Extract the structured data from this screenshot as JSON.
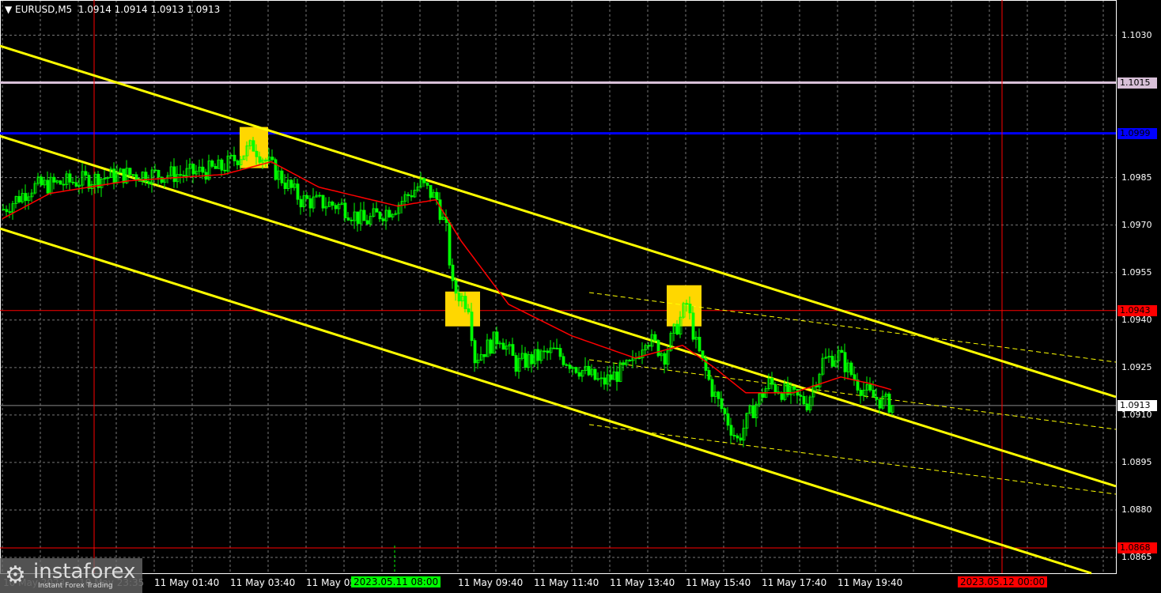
{
  "header": {
    "symbol": "EURUSD,M5",
    "ohlc": "1.0914 1.0914 1.0913 1.0913"
  },
  "logo": {
    "name": "instaforex",
    "tagline": "Instant Forex Trading"
  },
  "colors": {
    "bull": "#00ff00",
    "ma": "#ff0000",
    "channel": "#ffff00",
    "level_main": "#0000ff",
    "level_resist": "#d8c0d8",
    "level_red": "#ff0000",
    "box": "#ffd700"
  },
  "chart_data": {
    "type": "candlestick",
    "title": "EURUSD,M5",
    "ylim": [
      1.086,
      1.1042
    ],
    "y_ticks": [
      "1.1030",
      "1.1015",
      "1.0999",
      "1.0985",
      "1.0970",
      "1.0955",
      "1.0943",
      "1.0940",
      "1.0925",
      "1.0913",
      "1.0910",
      "1.0895",
      "1.0880",
      "1.0868",
      "1.0865"
    ],
    "x_ticks": [
      "10 May 2023",
      "10 May 23:35",
      "11 May 01:40",
      "11 May 03:40",
      "11 May 05",
      "11 May 09:40",
      "11 May 11:40",
      "11 May 13:40",
      "11 May 15:40",
      "11 May 17:40",
      "11 May 19:40"
    ],
    "x_markers": {
      "green": "2023.05.11 08:00",
      "red": "2023.05.12 00:00"
    },
    "price_levels": [
      {
        "label": "1.1015",
        "value": 1.1015,
        "kind": "resist"
      },
      {
        "label": "1.0999",
        "value": 1.0999,
        "kind": "main"
      },
      {
        "label": "1.0943",
        "value": 1.0943,
        "kind": "red"
      },
      {
        "label": "1.0913",
        "value": 1.0913,
        "kind": "current"
      },
      {
        "label": "1.0868",
        "value": 1.0868,
        "kind": "red"
      }
    ],
    "close_path_candle_index_price": [
      [
        0,
        1.0975
      ],
      [
        9,
        1.0982
      ],
      [
        24,
        1.0984
      ],
      [
        39,
        1.0986
      ],
      [
        57,
        1.0986
      ],
      [
        69,
        1.0988
      ],
      [
        79,
        1.0995
      ],
      [
        85,
        1.0988
      ],
      [
        94,
        1.0978
      ],
      [
        107,
        1.0976
      ],
      [
        114,
        1.0971
      ],
      [
        124,
        1.0976
      ],
      [
        132,
        1.0983
      ],
      [
        137,
        1.0978
      ],
      [
        140,
        1.0968
      ],
      [
        142,
        1.095
      ],
      [
        147,
        1.0945
      ],
      [
        149,
        1.0928
      ],
      [
        157,
        1.0935
      ],
      [
        162,
        1.0926
      ],
      [
        174,
        1.093
      ],
      [
        189,
        1.092
      ],
      [
        199,
        1.0926
      ],
      [
        203,
        1.0935
      ],
      [
        209,
        1.0929
      ],
      [
        216,
        1.0945
      ],
      [
        219,
        1.0932
      ],
      [
        224,
        1.0918
      ],
      [
        228,
        1.091
      ],
      [
        232,
        1.0902
      ],
      [
        237,
        1.0912
      ],
      [
        242,
        1.092
      ],
      [
        249,
        1.0916
      ],
      [
        254,
        1.0914
      ],
      [
        259,
        1.0927
      ],
      [
        264,
        1.0929
      ],
      [
        270,
        1.092
      ],
      [
        274,
        1.0916
      ],
      [
        281,
        1.0913
      ]
    ],
    "ma_path_candle_index_price": [
      [
        0,
        1.0972
      ],
      [
        15,
        1.098
      ],
      [
        40,
        1.0984
      ],
      [
        70,
        1.0986
      ],
      [
        85,
        1.099
      ],
      [
        100,
        1.0982
      ],
      [
        125,
        1.0976
      ],
      [
        137,
        1.0978
      ],
      [
        145,
        1.0965
      ],
      [
        160,
        1.0945
      ],
      [
        180,
        1.0935
      ],
      [
        200,
        1.0928
      ],
      [
        215,
        1.0932
      ],
      [
        225,
        1.0925
      ],
      [
        235,
        1.0917
      ],
      [
        250,
        1.0917
      ],
      [
        265,
        1.0922
      ],
      [
        274,
        1.092
      ],
      [
        281,
        1.0918
      ]
    ],
    "signal_boxes": [
      {
        "from": 75,
        "to": 84,
        "low": 1.0988,
        "high": 1.1001
      },
      {
        "from": 140,
        "to": 151,
        "low": 1.0938,
        "high": 1.0949
      },
      {
        "from": 210,
        "to": 221,
        "low": 1.0938,
        "high": 1.0951
      }
    ]
  }
}
